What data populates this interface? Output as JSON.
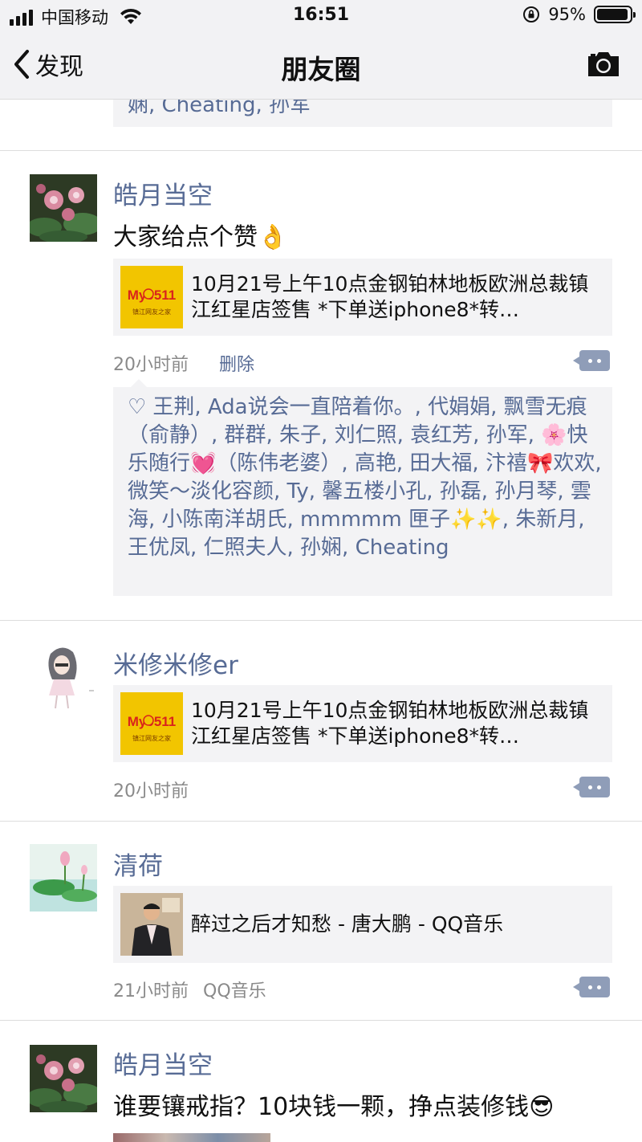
{
  "status_bar": {
    "carrier": "中国移动",
    "time": "16:51",
    "battery_percent": "95%",
    "battery_level": 0.95
  },
  "nav": {
    "back_label": "发现",
    "title": "朋友圈"
  },
  "feed": {
    "top_partial_likes": "娴, Cheating, 孙军",
    "posts": [
      {
        "name": "皓月当空",
        "text": "大家给点个赞👌",
        "link_title": "10月21号上午10点金钢铂林地板欧洲总裁镇江红星店签售 *下单送iphone8*转…",
        "link_thumb_text": "My0511",
        "link_thumb_sub": "镇江网友之家",
        "time": "20小时前",
        "delete_label": "删除",
        "likes": "王荆, Ada说会一直陪着你。, 代娟娟, 飘雪无痕（俞静）, 群群, 朱子, 刘仁照, 袁红芳, 孙军, 🌸快乐随行💓（陈伟老婆）, 高艳, 田大福, 汴禧🎀欢欢, 微笑～淡化容颜, Ty, 馨五楼小孔, 孙磊, 孙月琴, 雲海, 小陈南洋胡氏, mmmmm 匣子✨✨, 朱新月, 王优凤, 仁照夫人, 孙娴, Cheating"
      },
      {
        "name": "米修米修er",
        "link_title": "10月21号上午10点金钢铂林地板欧洲总裁镇江红星店签售 *下单送iphone8*转…",
        "link_thumb_text": "My0511",
        "link_thumb_sub": "镇江网友之家",
        "time": "20小时前"
      },
      {
        "name": "清荷",
        "link_title": "醉过之后才知愁 - 唐大鹏 - QQ音乐",
        "time": "21小时前",
        "source": "QQ音乐"
      },
      {
        "name": "皓月当空",
        "text": "谁要镶戒指？10块钱一颗，挣点装修钱😎"
      }
    ]
  },
  "colors": {
    "link_blue": "#576b95",
    "card_bg": "#f3f3f5",
    "nav_bg": "#f2f2f4",
    "comment_btn": "#8f9db8"
  }
}
